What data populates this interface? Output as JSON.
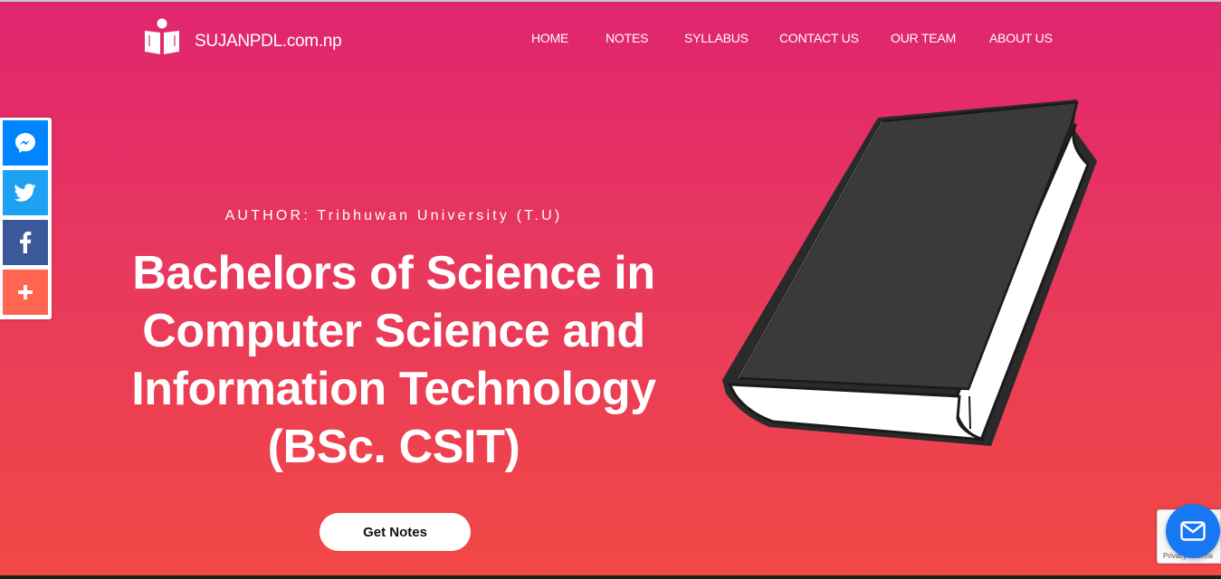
{
  "logo": {
    "text": "SUJANPDL.com.np",
    "icon": "book-reader-icon"
  },
  "nav": {
    "items": [
      {
        "label": "HOME"
      },
      {
        "label": "NOTES"
      },
      {
        "label": "SYLLABUS"
      },
      {
        "label": "CONTACT US"
      },
      {
        "label": "OUR TEAM"
      },
      {
        "label": "ABOUT US"
      }
    ]
  },
  "share": {
    "buttons": [
      {
        "name": "messenger",
        "icon": "messenger-icon",
        "color": "#0084ff"
      },
      {
        "name": "twitter",
        "icon": "twitter-icon",
        "color": "#1da1f2"
      },
      {
        "name": "facebook",
        "icon": "facebook-icon",
        "color": "#3b5998"
      },
      {
        "name": "more",
        "icon": "plus-icon",
        "color": "#ff6550"
      }
    ]
  },
  "hero": {
    "author": "AUTHOR: Tribhuwan University (T.U)",
    "title_lines": [
      "Bachelors of Science in",
      "Computer Science and",
      "Information Technology",
      "(BSc. CSIT)"
    ],
    "cta_label": "Get Notes"
  },
  "recaptcha": {
    "links": "Privacy - Terms"
  },
  "chat": {
    "icon": "mail-icon",
    "color": "#1877f2"
  },
  "colors": {
    "gradient_top": "#e0256f",
    "gradient_bottom": "#f24845",
    "book_cover": "#333333"
  }
}
